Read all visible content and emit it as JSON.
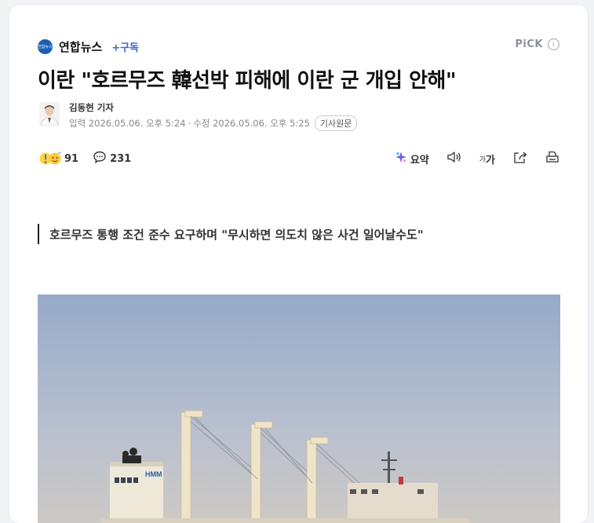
{
  "press": {
    "logo_text": "연합뉴스",
    "name": "연합뉴스",
    "subscribe": "+구독"
  },
  "pick": {
    "label": "PiCK",
    "info": "i"
  },
  "headline": "이란 \"호르무즈 韓선박 피해에 이란 군 개입 안해\"",
  "reporter": {
    "name": "김동현 기자",
    "published": "입력 2026.05.06. 오후 5:24",
    "separator": "·",
    "modified": "수정 2026.05.06. 오후 5:25",
    "original_button": "기사원문"
  },
  "toolbar": {
    "reactions_count": "91",
    "comments_count": "231",
    "summary_label": "요약",
    "font_small": "가",
    "font_large": "가"
  },
  "subhead": "호르무즈 통행 조건 준수 요구하며 \"무시하면 의도치 않은 사건 일어날수도\"",
  "photo": {
    "ship_marking": "HMM"
  },
  "colors": {
    "accent": "#3a68d6",
    "press_logo": "#1a5fb4"
  }
}
